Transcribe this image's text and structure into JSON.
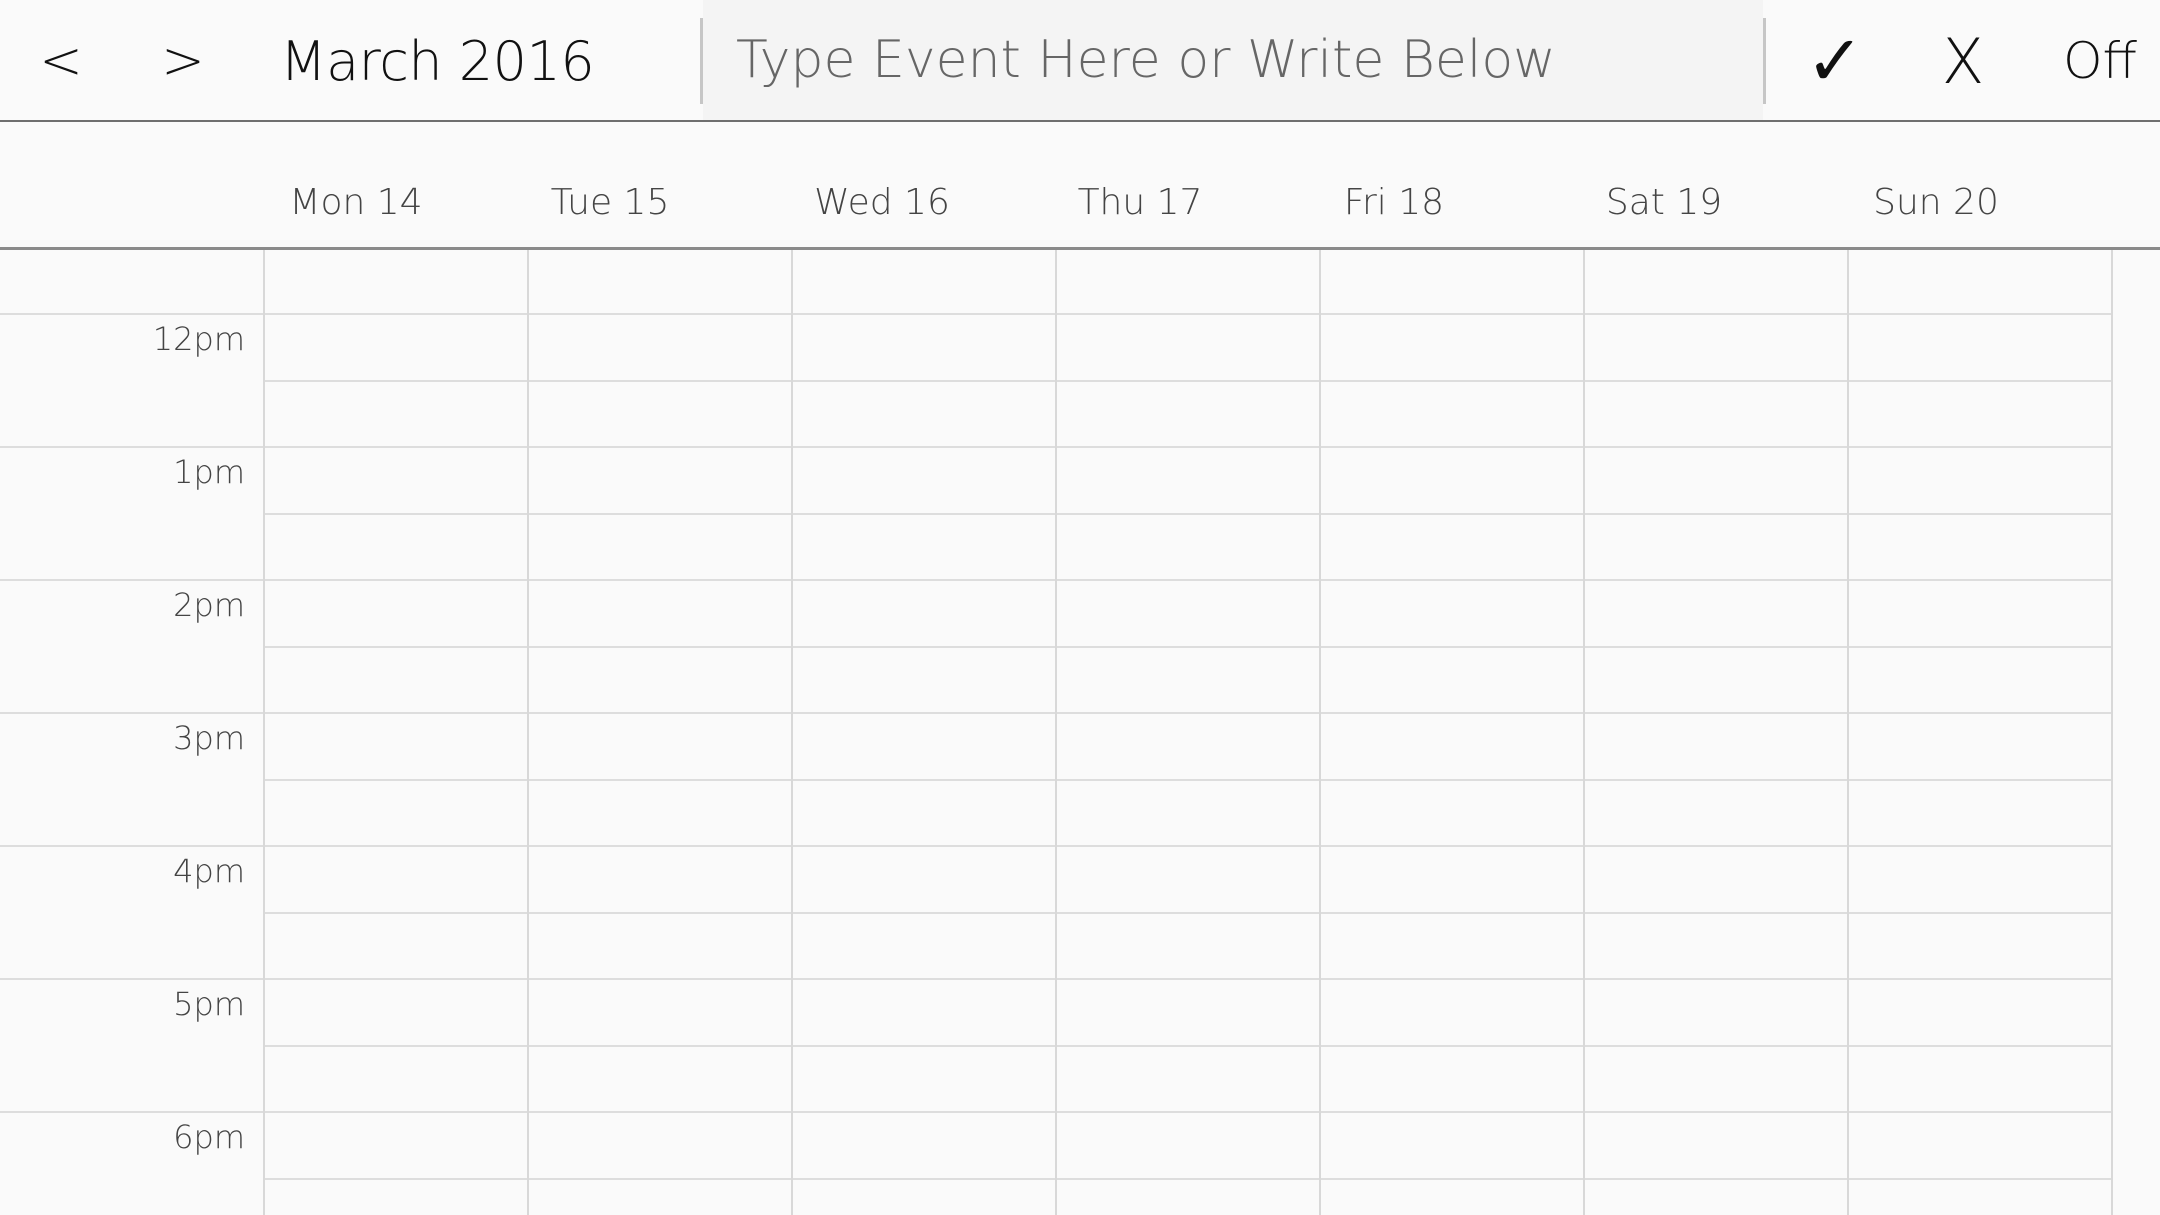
{
  "toolbar": {
    "prev_label": "<",
    "next_label": ">",
    "month_title": "March 2016",
    "event_placeholder": "Type Event Here or Write Below",
    "confirm_label": "✓",
    "cancel_label": "X",
    "toggle_label": "Off"
  },
  "week": {
    "days": [
      "Mon 14",
      "Tue 15",
      "Wed 16",
      "Thu 17",
      "Fri 18",
      "Sat 19",
      "Sun 20"
    ]
  },
  "grid": {
    "time_labels": [
      "12pm",
      "1pm",
      "2pm",
      "3pm",
      "4pm",
      "5pm",
      "6pm"
    ]
  }
}
